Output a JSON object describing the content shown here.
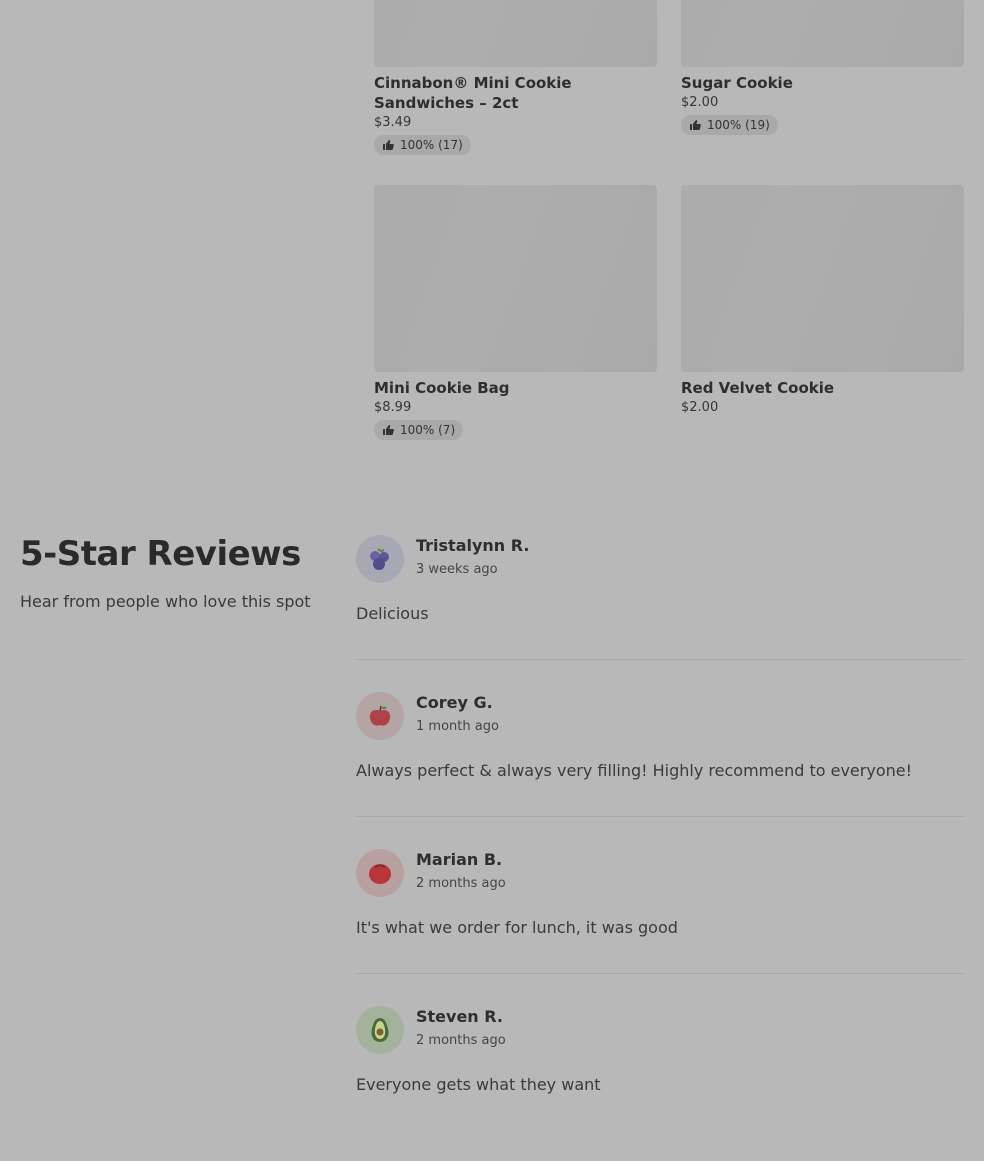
{
  "products": [
    {
      "name": "Cinnabon® Mini Cookie Sandwiches – 2ct",
      "price": "$3.49",
      "rating": "100% (17)"
    },
    {
      "name": "Sugar Cookie",
      "price": "$2.00",
      "rating": "100% (19)"
    },
    {
      "name": "Mini Cookie Bag",
      "price": "$8.99",
      "rating": "100% (7)"
    },
    {
      "name": "Red Velvet Cookie",
      "price": "$2.00",
      "rating": null
    }
  ],
  "reviews_section": {
    "title": "5-Star Reviews",
    "subtitle": "Hear from people who love this spot"
  },
  "reviews": [
    {
      "author": "Tristalynn R.",
      "time": "3 weeks ago",
      "text": "Delicious",
      "avatar_icon": "blueberry-icon",
      "avatar_bg": "#a8a8b4"
    },
    {
      "author": "Corey G.",
      "time": "1 month ago",
      "text": "Always perfect & always very filling! Highly recommend to everyone!",
      "avatar_icon": "apple-icon",
      "avatar_bg": "#b4a4a4"
    },
    {
      "author": "Marian B.",
      "time": "2 months ago",
      "text": "It's what we order for lunch, it was good",
      "avatar_icon": "tomato-icon",
      "avatar_bg": "#b8a0a0"
    },
    {
      "author": "Steven R.",
      "time": "2 months ago",
      "text": "Everyone gets what they want",
      "avatar_icon": "avocado-icon",
      "avatar_bg": "#a4b29c"
    }
  ]
}
